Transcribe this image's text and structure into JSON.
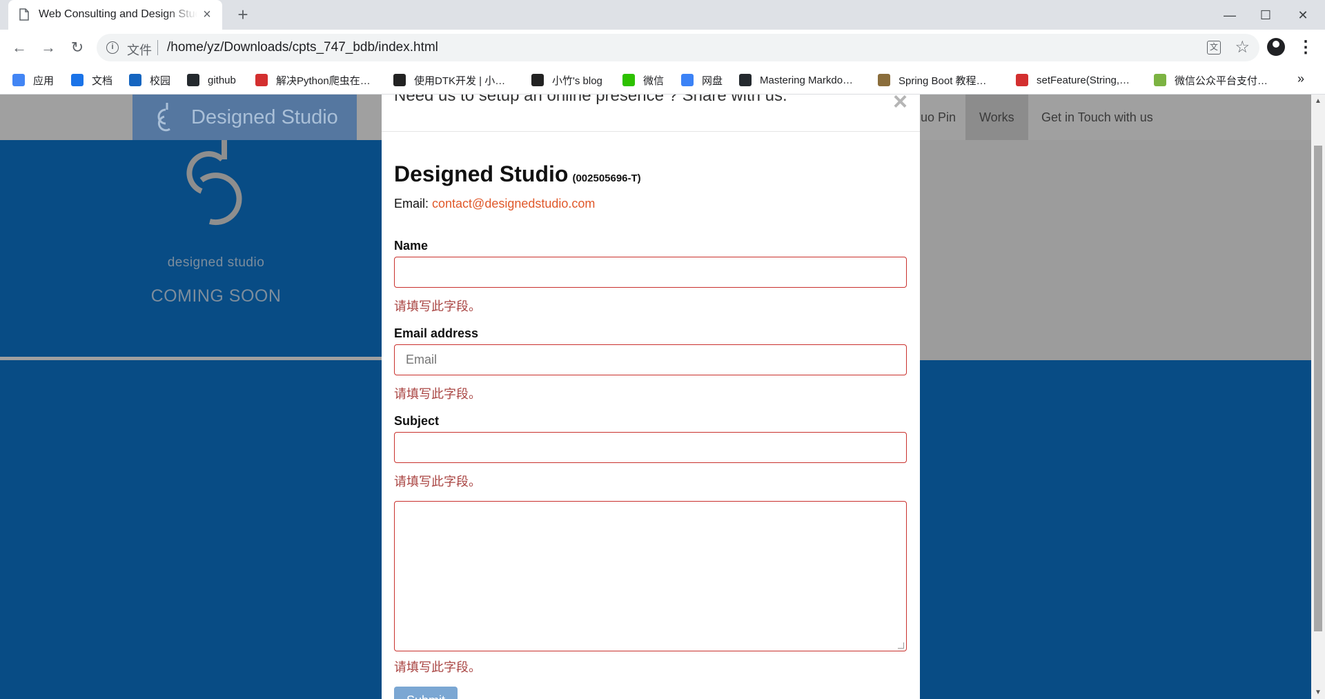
{
  "browser": {
    "tab_title": "Web Consulting and Design Studio",
    "tab_close": "×",
    "new_tab": "+",
    "minimize": "—",
    "maximize": "☐",
    "close": "✕",
    "back": "←",
    "forward": "→",
    "reload": "↻",
    "scheme": "文件",
    "url": "/home/yz/Downloads/cpts_747_bdb/index.html",
    "translate": "文",
    "star": "☆",
    "menu": "⋮",
    "bookmarks": [
      {
        "label": "应用",
        "color": "#4285f4"
      },
      {
        "label": "文档",
        "color": "#1a73e8"
      },
      {
        "label": "校园",
        "color": "#1565c0"
      },
      {
        "label": "github",
        "color": "#24292e"
      },
      {
        "label": "解决Python爬虫在…",
        "color": "#d32f2f"
      },
      {
        "label": "使用DTK开发 | 小…",
        "color": "#222222"
      },
      {
        "label": "小竹's blog",
        "color": "#222222"
      },
      {
        "label": "微信",
        "color": "#2dc100"
      },
      {
        "label": "网盘",
        "color": "#3b82f6"
      },
      {
        "label": "Mastering Markdo…",
        "color": "#24292e"
      },
      {
        "label": "Spring Boot 教程…",
        "color": "#8a6d3b"
      },
      {
        "label": "setFeature(String,…",
        "color": "#d32f2f"
      },
      {
        "label": "微信公众平台支付…",
        "color": "#7cb342"
      }
    ],
    "bookmarks_more": "»"
  },
  "site": {
    "logo_text": "Designed Studio",
    "nav": [
      {
        "label": "uo Pin",
        "active": false
      },
      {
        "label": "Works",
        "active": true
      },
      {
        "label": "Get in Touch with us",
        "active": false
      }
    ],
    "hero_brand": "designed studio",
    "hero_soon": "COMING SOON"
  },
  "modal": {
    "title": "Need us to setup an online presence ? Share with us.",
    "close": "×",
    "company_name": "Designed Studio",
    "company_reg": "(002505696-T)",
    "email_label": "Email: ",
    "email_value": "contact@designedstudio.com",
    "fields": {
      "name_label": "Name",
      "name_value": "",
      "email_label": "Email address",
      "email_placeholder": "Email",
      "subject_label": "Subject",
      "subject_value": "",
      "message_value": ""
    },
    "error": "请填写此字段。",
    "submit": "Submit"
  },
  "colors": {
    "page_blue": "#084c85",
    "nav_gray": "#a0a0a0",
    "error_red": "#a94442",
    "link_orange": "#e0582a",
    "submit_blue": "#7ba7d3"
  },
  "scrollbar": {
    "up": "▲",
    "down": "▼"
  }
}
